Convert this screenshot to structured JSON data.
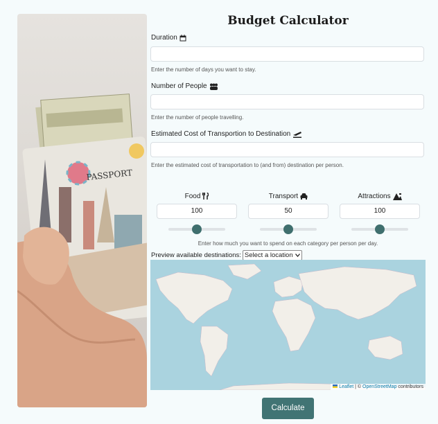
{
  "title": "Budget Calculator",
  "fields": [
    {
      "label": "Duration",
      "value": "",
      "help": "Enter the number of days you want to stay."
    },
    {
      "label": "Number of People",
      "value": "",
      "help": "Enter the number of people travelling."
    },
    {
      "label": "Estimated Cost of Transportion to Destination",
      "value": "",
      "help": "Enter the estimated cost of transportation to (and from) destination per person."
    }
  ],
  "categories": [
    {
      "label": "Food",
      "value": "100",
      "slider_fraction": 0.5
    },
    {
      "label": "Transport",
      "value": "50",
      "slider_fraction": 0.5
    },
    {
      "label": "Attractions",
      "value": "100",
      "slider_fraction": 0.5
    }
  ],
  "category_help": "Enter how much you want to spend on each category per person per day.",
  "preview": {
    "label": "Preview available destinations:",
    "selected": "Select a location"
  },
  "map": {
    "leaflet": "Leaflet",
    "sep": "| ©",
    "osm": "OpenStreetMap",
    "contributors": "contributors"
  },
  "photo": {
    "passport_text": "PASSPORT"
  },
  "calculate_label": "Calculate",
  "colors": {
    "accent": "#417474",
    "slider_thumb": "#3f6f6e",
    "ocean": "#aad3df",
    "land": "#f2efe9"
  }
}
